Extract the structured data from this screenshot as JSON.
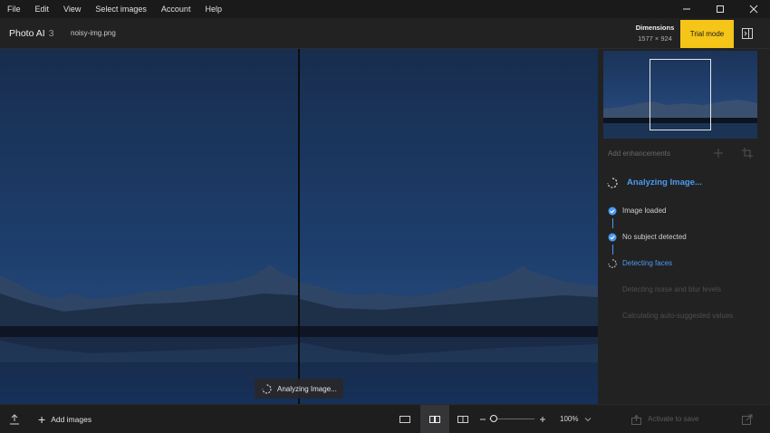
{
  "menu": [
    "File",
    "Edit",
    "View",
    "Select images",
    "Account",
    "Help"
  ],
  "window_controls": [
    "minimize-icon",
    "maximize-icon",
    "close-icon"
  ],
  "header": {
    "app_name": "Photo AI",
    "app_version": "3",
    "file_name": "noisy-img.png",
    "dimensions_label": "Dimensions",
    "dimensions_value": "1577 × 924",
    "trial_button": "Trial mode"
  },
  "canvas": {
    "toast_text": "Analyzing Image..."
  },
  "panel": {
    "add_enhancements": "Add enhancements",
    "analyzing_title": "Analyzing Image...",
    "steps": [
      {
        "label": "Image loaded",
        "state": "done"
      },
      {
        "label": "No subject detected",
        "state": "done"
      },
      {
        "label": "Detecting faces",
        "state": "active"
      },
      {
        "label": "Detecting noise and blur levels",
        "state": "pending"
      },
      {
        "label": "Calculating auto-suggested values",
        "state": "pending"
      }
    ]
  },
  "bottom": {
    "add_images": "Add images",
    "zoom_value": "100%",
    "zoom_fraction": 0.1,
    "activate_label": "Activate to save"
  },
  "colors": {
    "accent": "#4b9af0",
    "trial": "#f5c518",
    "background": "#1e1e1f",
    "panel": "#222223",
    "sky": "#1c3a66"
  }
}
